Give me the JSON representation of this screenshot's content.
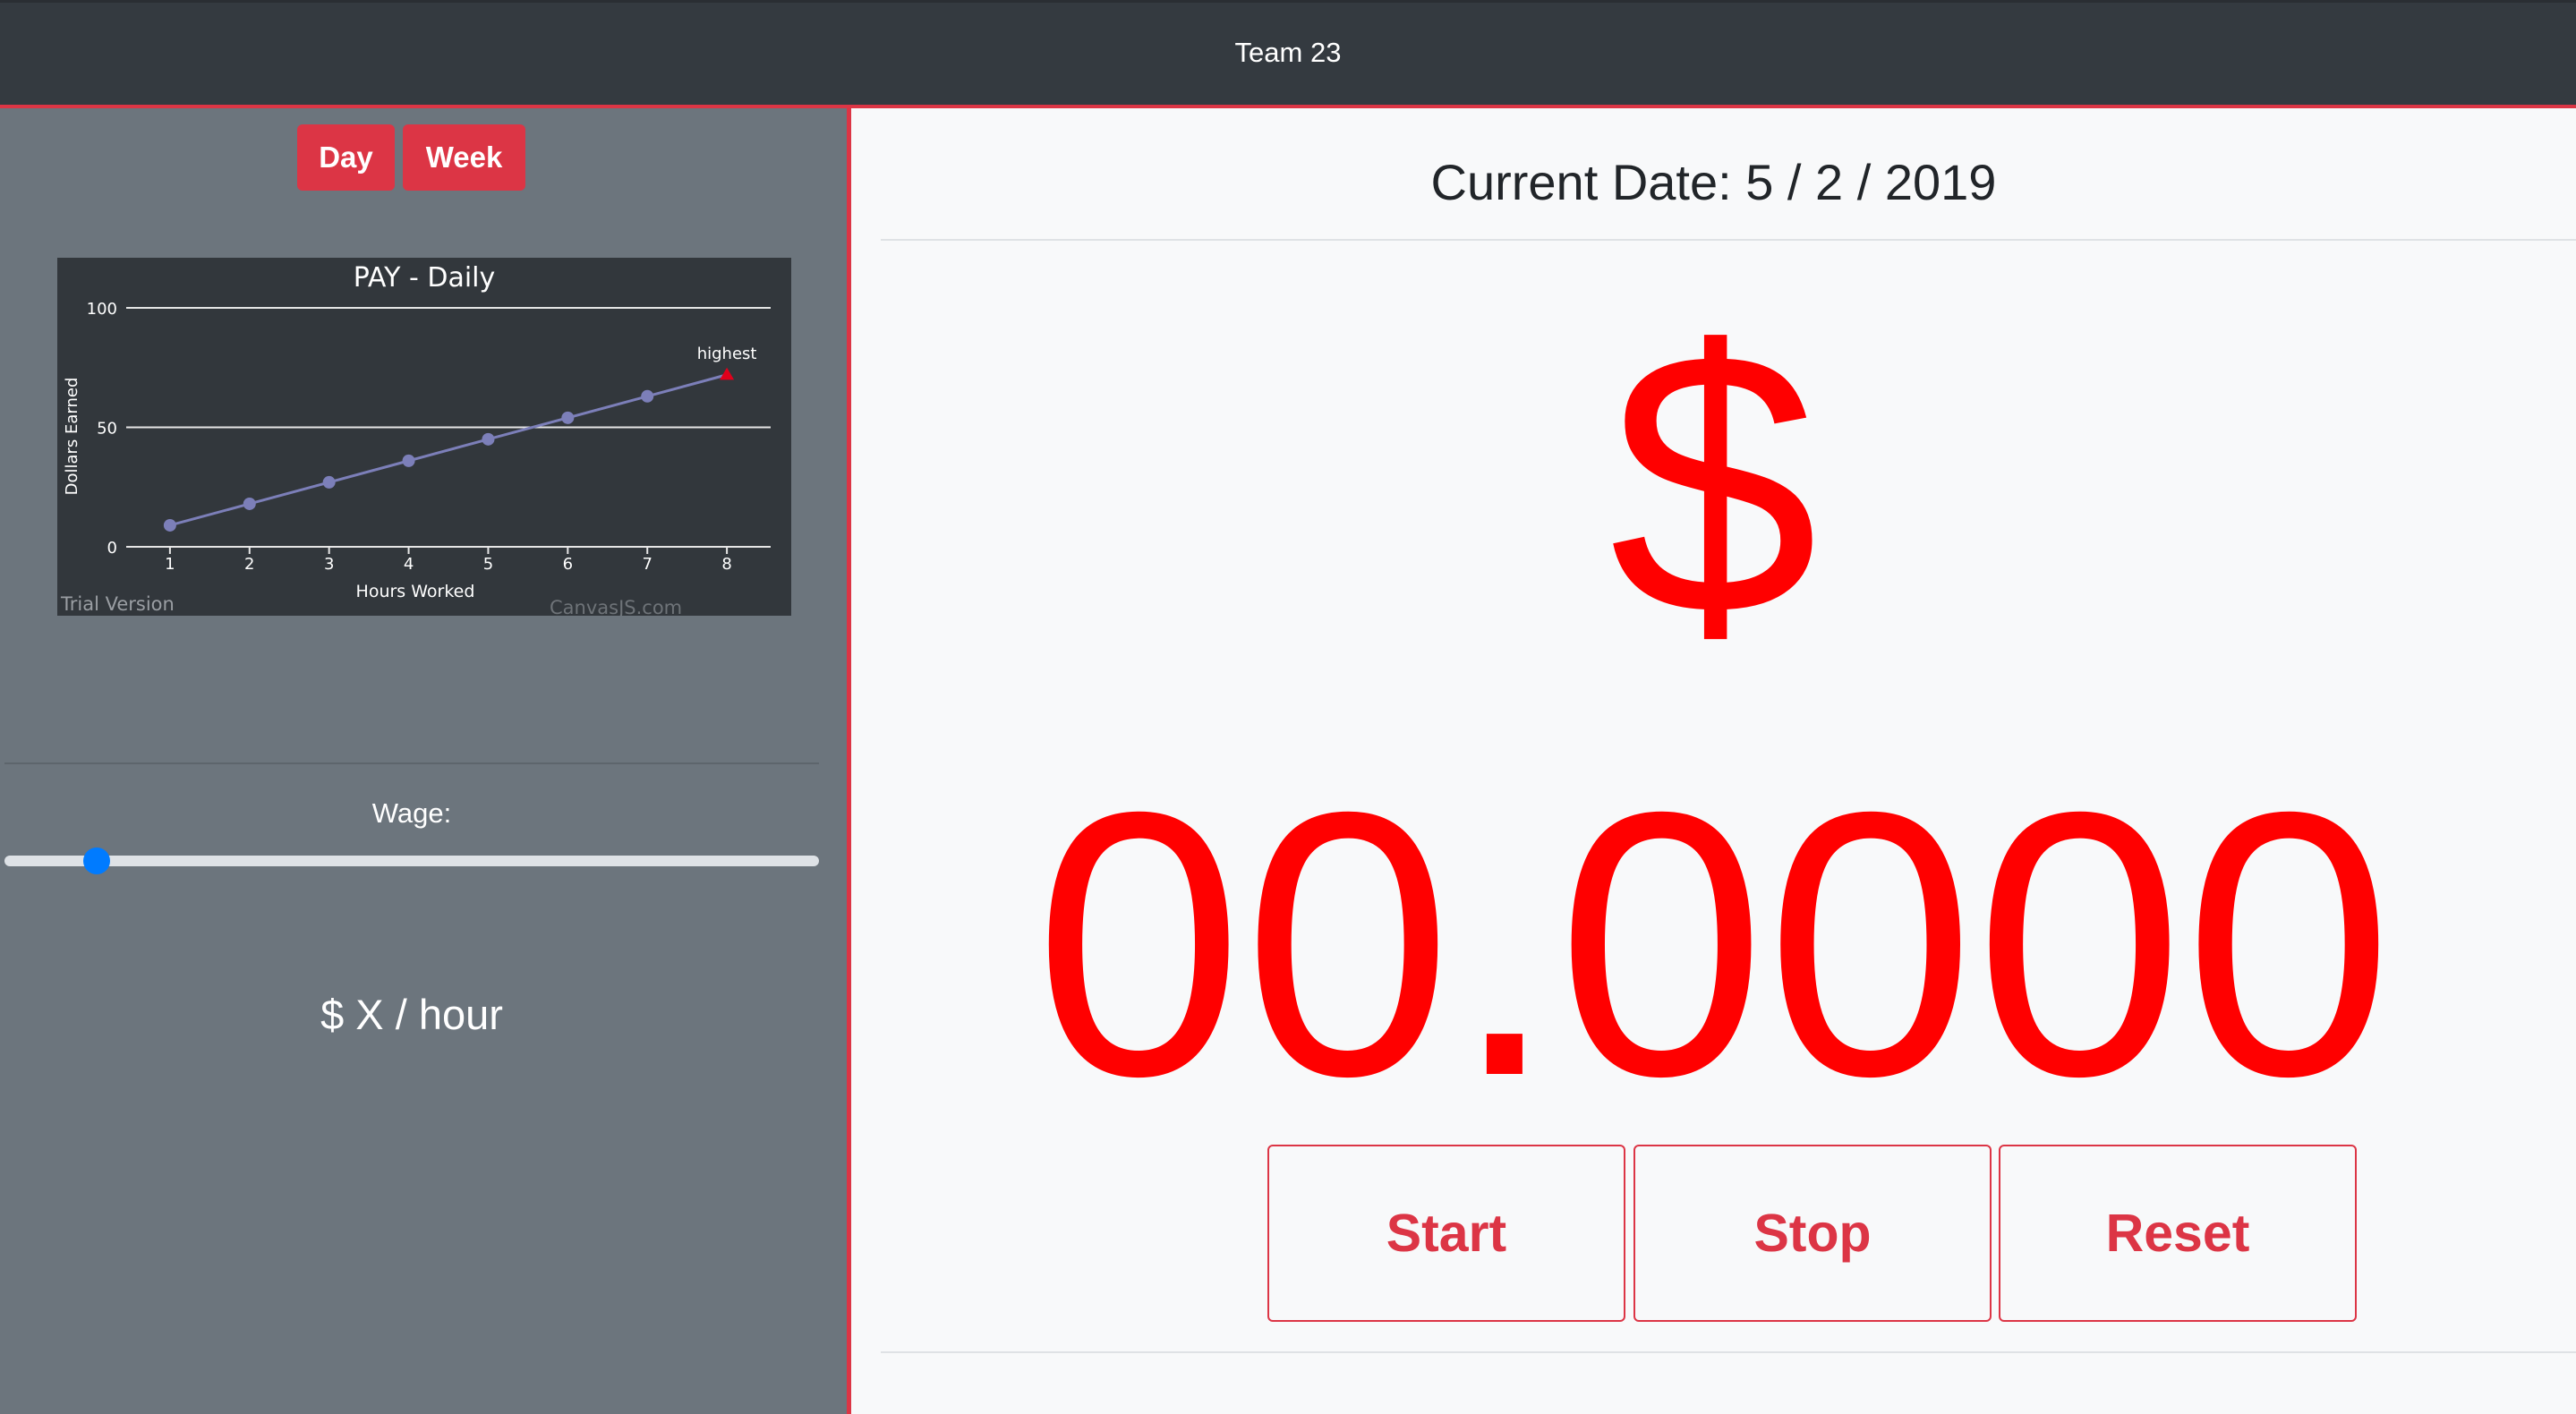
{
  "header": {
    "title": "Team 23"
  },
  "sidebar": {
    "period_buttons": {
      "day": "Day",
      "week": "Week"
    },
    "wage_label": "Wage:",
    "wage_rate": "$ X / hour",
    "wage_slider_fraction": 0.1
  },
  "main": {
    "current_date": "Current Date: 5 / 2 / 2019",
    "currency_symbol": "$",
    "amount": "00.0000",
    "buttons": {
      "start": "Start",
      "stop": "Stop",
      "reset": "Reset"
    }
  },
  "colors": {
    "accent": "#dc3545",
    "amount": "#ff0000",
    "slider_thumb": "#007bff",
    "header_bg": "#343a40",
    "sidebar_bg": "#6c757d"
  },
  "chart_data": {
    "type": "line",
    "title": "PAY - Daily",
    "xlabel": "Hours Worked",
    "ylabel": "Dollars Earned",
    "x": [
      1,
      2,
      3,
      4,
      5,
      6,
      7,
      8
    ],
    "series": [
      {
        "values": [
          9,
          18,
          27,
          36,
          45,
          54,
          63,
          72
        ]
      }
    ],
    "ylim": [
      0,
      100
    ],
    "yticks": [
      0,
      50,
      100
    ],
    "xticks": [
      1,
      2,
      3,
      4,
      5,
      6,
      7,
      8
    ],
    "annotations": [
      {
        "x": 8,
        "y": 72,
        "text": "highest"
      }
    ],
    "watermarks": [
      "Trial Version",
      "CanvasJS.com"
    ],
    "grid": true,
    "colors": {
      "line": "#7c7fb9",
      "highlight": "#e0001b"
    }
  }
}
